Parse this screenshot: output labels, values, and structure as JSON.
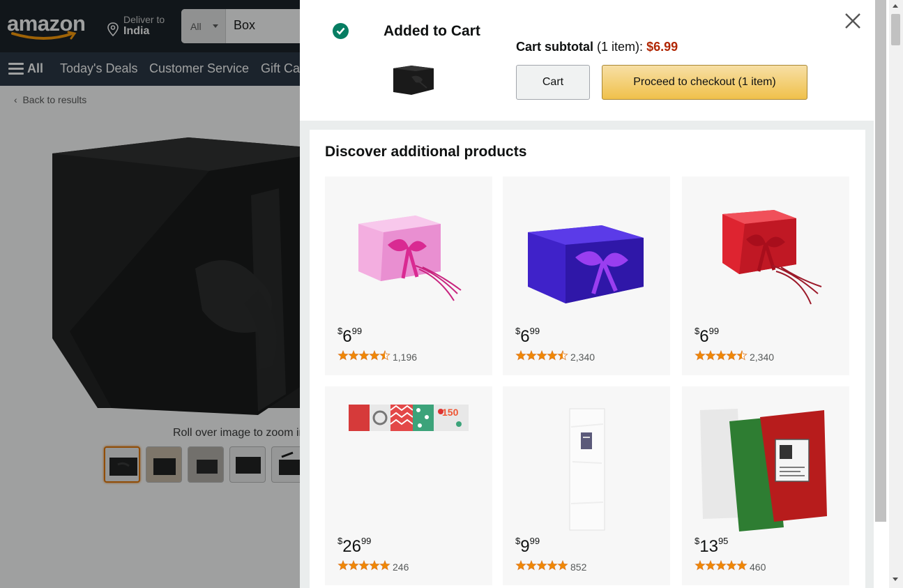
{
  "header": {
    "logo": "amazon",
    "deliver_line1": "Deliver to",
    "deliver_line2": "India",
    "search_category": "All",
    "search_value": "Box"
  },
  "subnav": {
    "all": "All",
    "items": [
      "Today's Deals",
      "Customer Service",
      "Gift Ca"
    ]
  },
  "product_page": {
    "back_link": "Back to results",
    "roll_text": "Roll over image to zoom in"
  },
  "panel": {
    "added_title": "Added to Cart",
    "subtotal_label": "Cart subtotal",
    "subtotal_items": "(1 item):",
    "subtotal_price": "$6.99",
    "cart_button": "Cart",
    "checkout_button": "Proceed to checkout (1 item)",
    "discover_title": "Discover additional products"
  },
  "products": [
    {
      "sym": "$",
      "whole": "6",
      "frac": "99",
      "count": "1,196",
      "rating": 4.5,
      "color": "#f0a6d8",
      "ribbon": "#d4218c"
    },
    {
      "sym": "$",
      "whole": "6",
      "frac": "99",
      "count": "2,340",
      "rating": 4.5,
      "color": "#4b2bd6",
      "ribbon": "#8a2be2"
    },
    {
      "sym": "$",
      "whole": "6",
      "frac": "99",
      "count": "2,340",
      "rating": 4.5,
      "color": "#d01c2a",
      "ribbon": "#a01020"
    },
    {
      "sym": "$",
      "whole": "26",
      "frac": "99",
      "count": "246",
      "rating": 5,
      "color": "#d33"
    },
    {
      "sym": "$",
      "whole": "9",
      "frac": "99",
      "count": "852",
      "rating": 5,
      "color": "#fafafa"
    },
    {
      "sym": "$",
      "whole": "13",
      "frac": "95",
      "count": "460",
      "rating": 5,
      "color": "#2e7d32"
    }
  ],
  "colors": {
    "nav_dark": "#131921",
    "nav_secondary": "#232f3e",
    "price_red": "#b12704",
    "star_orange": "#f08804",
    "check_green": "#067d62"
  }
}
